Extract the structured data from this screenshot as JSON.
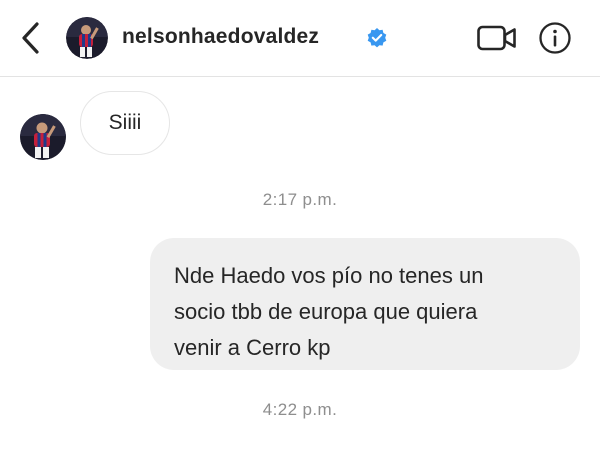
{
  "header": {
    "username": "nelsonhaedovaldez",
    "icons": {
      "back": "chevron-left-icon",
      "verified": "verified-badge-icon",
      "video": "video-call-icon",
      "info": "info-icon"
    },
    "colors": {
      "verified": "#3897f0",
      "divider": "#e3e3e3"
    }
  },
  "messages": [
    {
      "type": "incoming",
      "text": "Siiii"
    },
    {
      "type": "timestamp",
      "text": "2:17 p.m."
    },
    {
      "type": "outgoing",
      "lines": [
        "Nde Haedo vos pío no tenes un",
        "socio tbb de europa que quiera",
        "venir a Cerro kp"
      ]
    },
    {
      "type": "timestamp",
      "text": "4:22 p.m."
    }
  ],
  "colors": {
    "outgoing_bubble": "#efefef",
    "incoming_border": "#e6e6e6",
    "timestamp_text": "#8e8e8e"
  }
}
